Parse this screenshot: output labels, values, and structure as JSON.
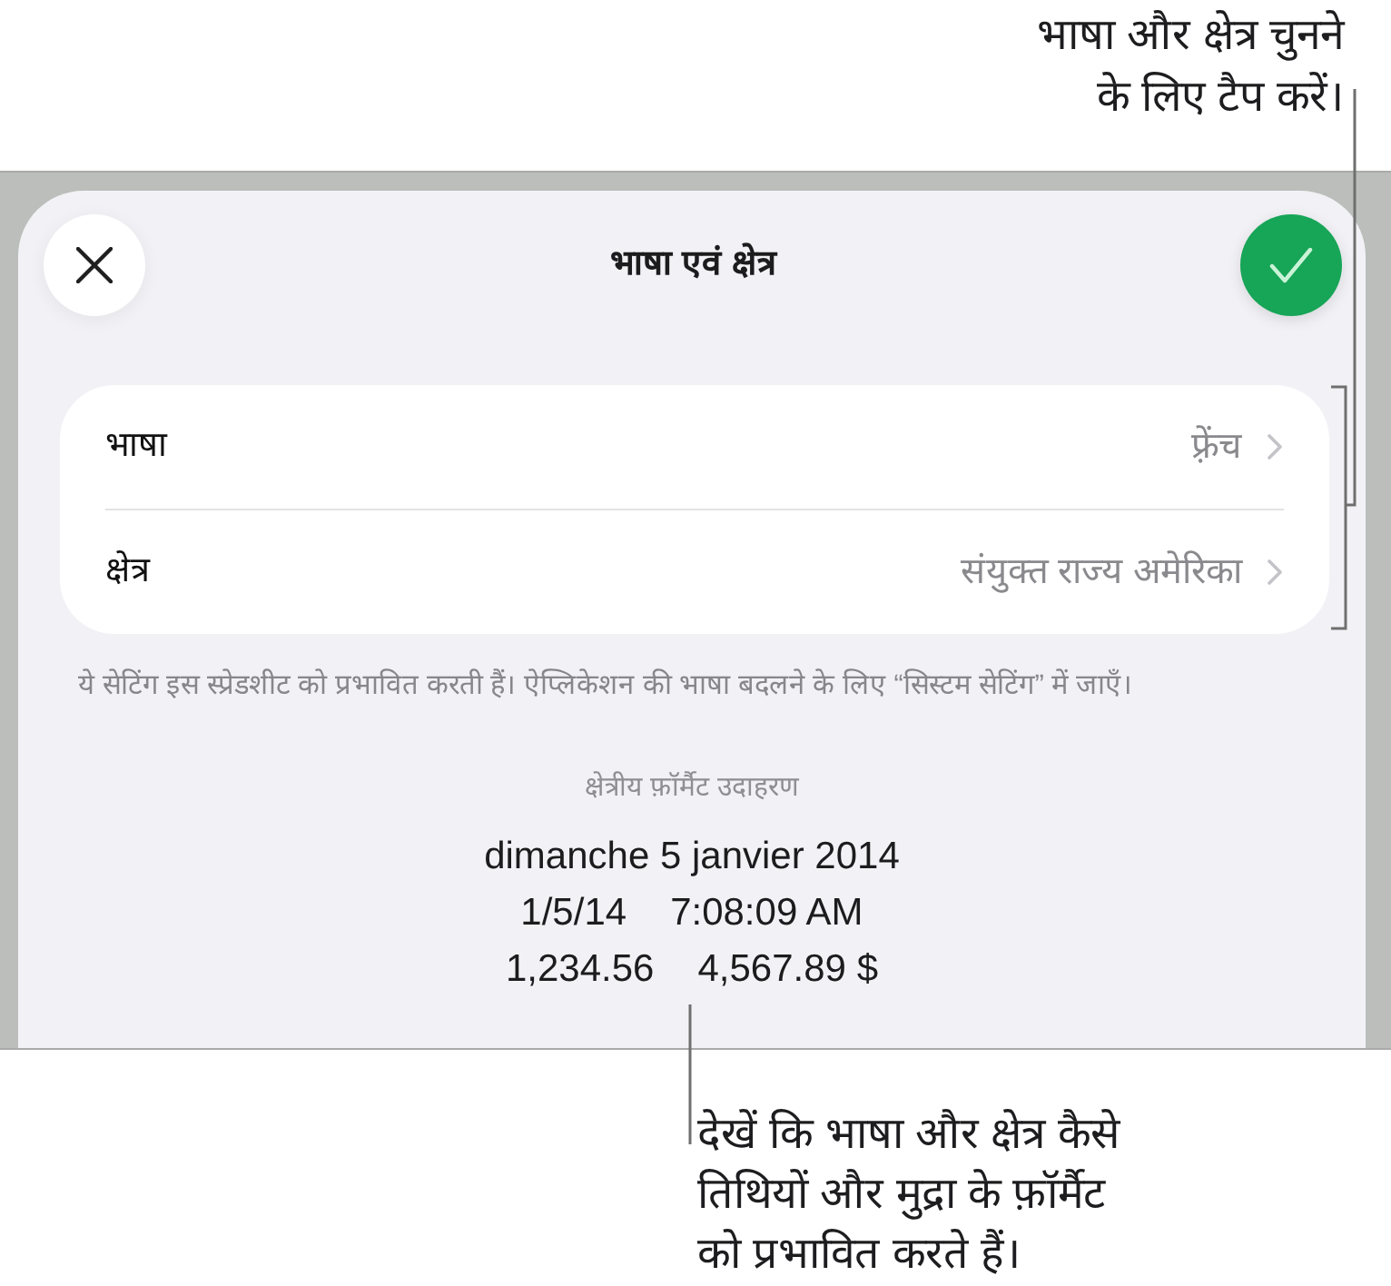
{
  "top_callout": {
    "lines": [
      "भाषा और क्षेत्र चुनने",
      "के लिए टैप करें।"
    ]
  },
  "sheet": {
    "title": "भाषा एवं क्षेत्र",
    "settings": [
      {
        "label": "भाषा",
        "value": "फ़्रेंच"
      },
      {
        "label": "क्षेत्र",
        "value": "संयुक्त राज्य अमेरिका"
      }
    ],
    "footnote": "ये सेटिंग इस स्प्रेडशीट को प्रभावित करती हैं। ऐप्लिकेशन की भाषा बदलने के लिए “सिस्टम सेटिंग” में जाएँ।",
    "format_example": {
      "heading": "क्षेत्रीय फ़ॉर्मैट उदाहरण",
      "lines": [
        [
          "dimanche 5 janvier 2014"
        ],
        [
          "1/5/14",
          "7:08:09 AM"
        ],
        [
          "1,234.56",
          "4,567.89 $"
        ]
      ]
    }
  },
  "bottom_callout": {
    "lines": [
      "देखें कि भाषा और क्षेत्र कैसे",
      "तिथियों और मुद्रा के फ़ॉर्मैट",
      "को प्रभावित करते हैं।"
    ]
  }
}
